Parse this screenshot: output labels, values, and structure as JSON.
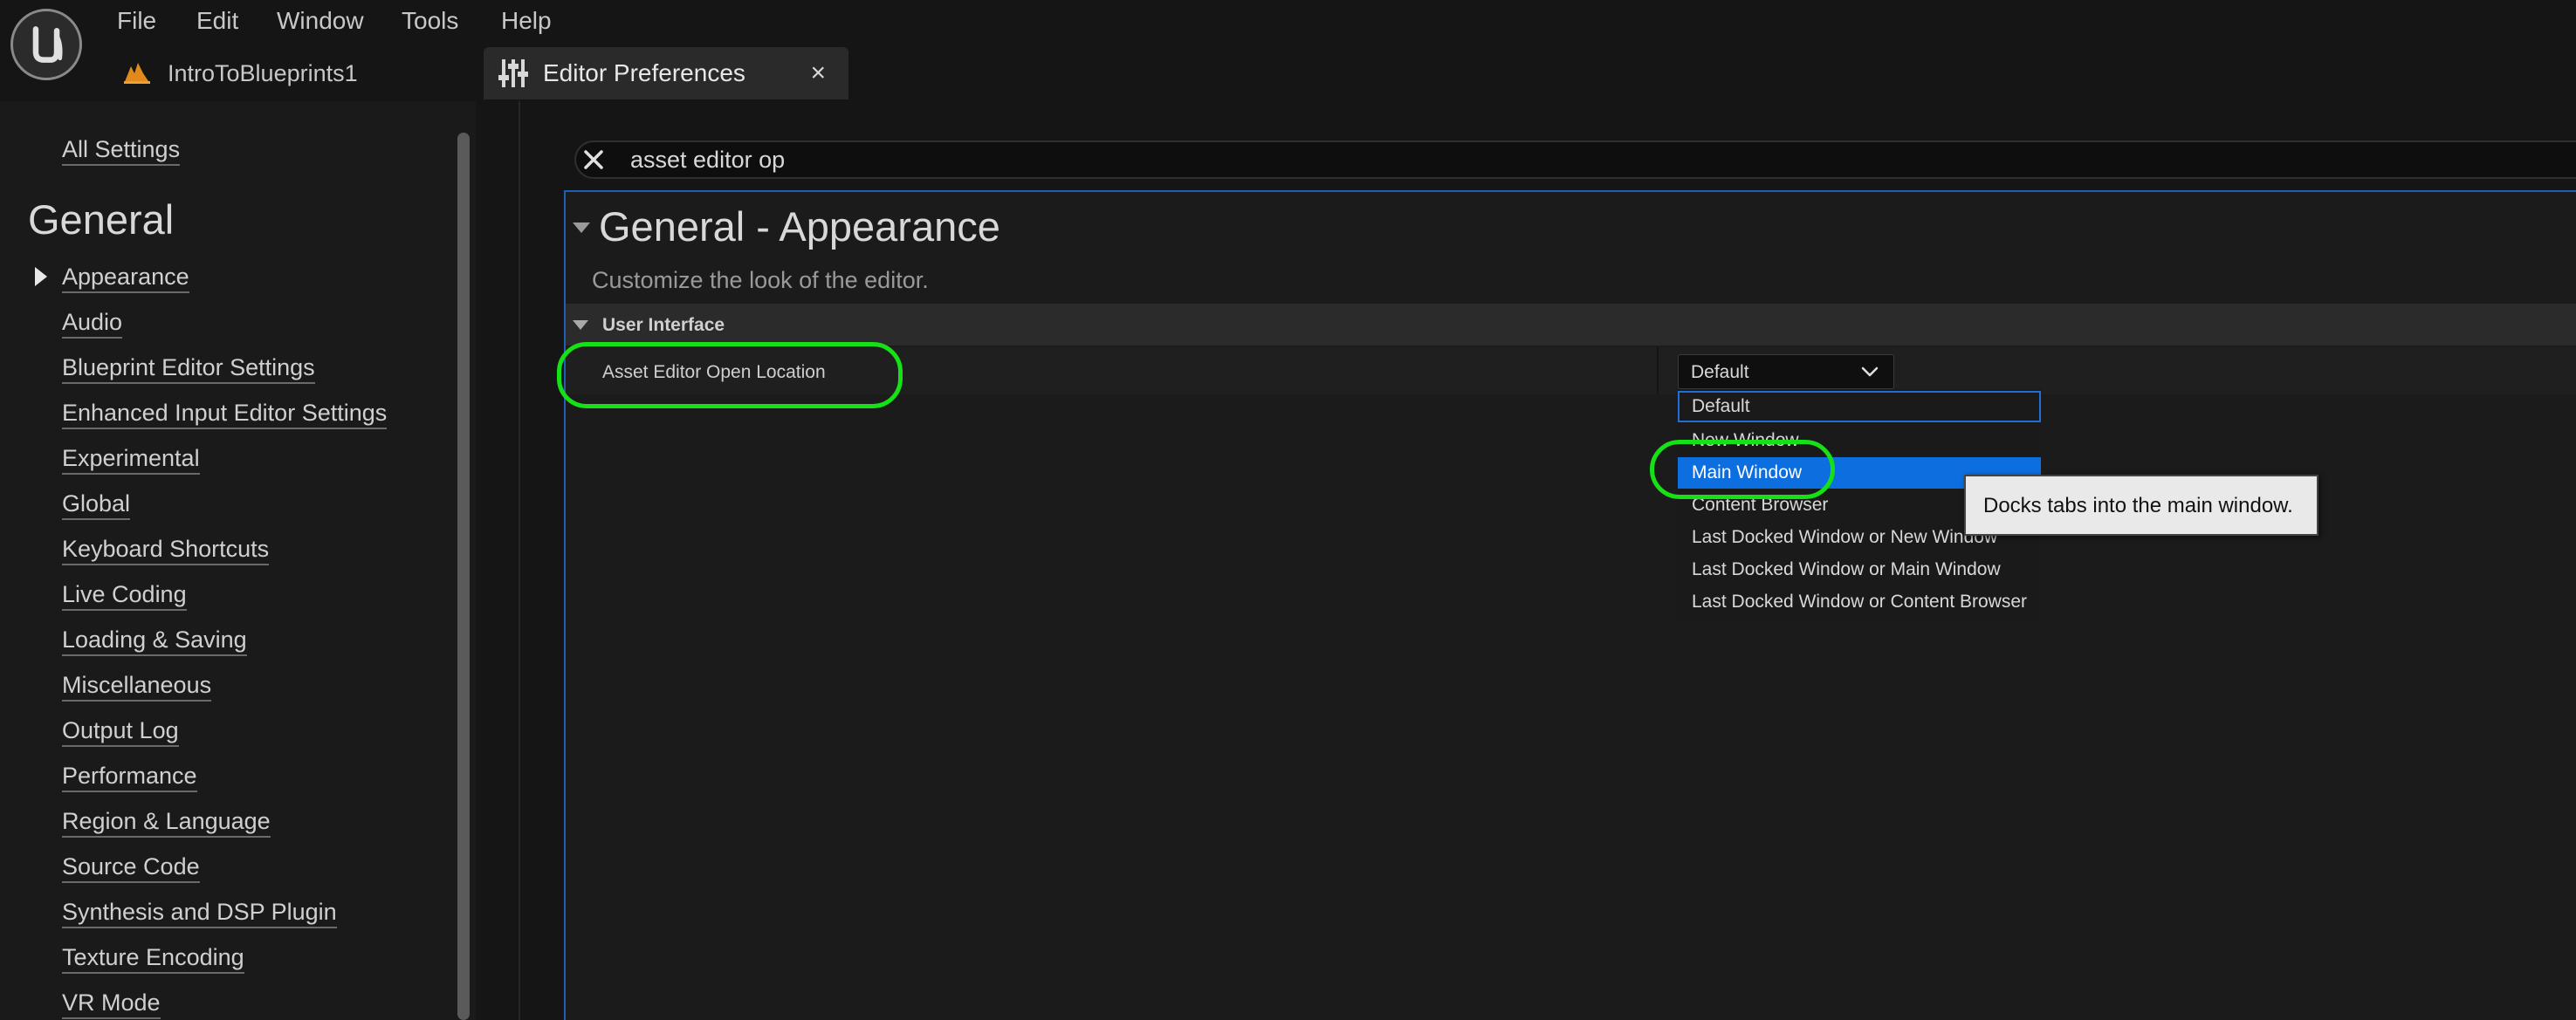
{
  "menu": [
    "File",
    "Edit",
    "Window",
    "Tools",
    "Help"
  ],
  "tabs": {
    "project": "IntroToBlueprints1",
    "editor_preferences": "Editor Preferences",
    "close_glyph": "×"
  },
  "sidebar": {
    "all_settings": "All Settings",
    "heading": "General",
    "active_item": "Appearance",
    "items": [
      "Appearance",
      "Audio",
      "Blueprint Editor Settings",
      "Enhanced Input Editor Settings",
      "Experimental",
      "Global",
      "Keyboard Shortcuts",
      "Live Coding",
      "Loading & Saving",
      "Miscellaneous",
      "Output Log",
      "Performance",
      "Region & Language",
      "Source Code",
      "Synthesis and DSP Plugin",
      "Texture Encoding",
      "VR Mode"
    ]
  },
  "search": {
    "value": "asset editor op"
  },
  "section": {
    "title": "General - Appearance",
    "description": "Customize the look of the editor.",
    "category": "User Interface"
  },
  "property": {
    "label": "Asset Editor Open Location",
    "value": "Default",
    "options": [
      "Default",
      "New Window",
      "Main Window",
      "Content Browser",
      "Last Docked Window or New Window",
      "Last Docked Window or Main Window",
      "Last Docked Window or Content Browser"
    ],
    "hovered_option": "Default",
    "highlighted_option": "Main Window"
  },
  "tooltip": "Docks tabs into the main window.",
  "colors": {
    "background": "#151515",
    "selection": "#0d6ee0",
    "focus_outline": "#1f6fd6",
    "annotation": "#16e016"
  },
  "icons": {
    "logo": "unreal-engine-logo-icon",
    "project": "level-icon",
    "preferences": "sliders-icon",
    "clear": "close-icon",
    "combo": "chevron-down-icon"
  }
}
